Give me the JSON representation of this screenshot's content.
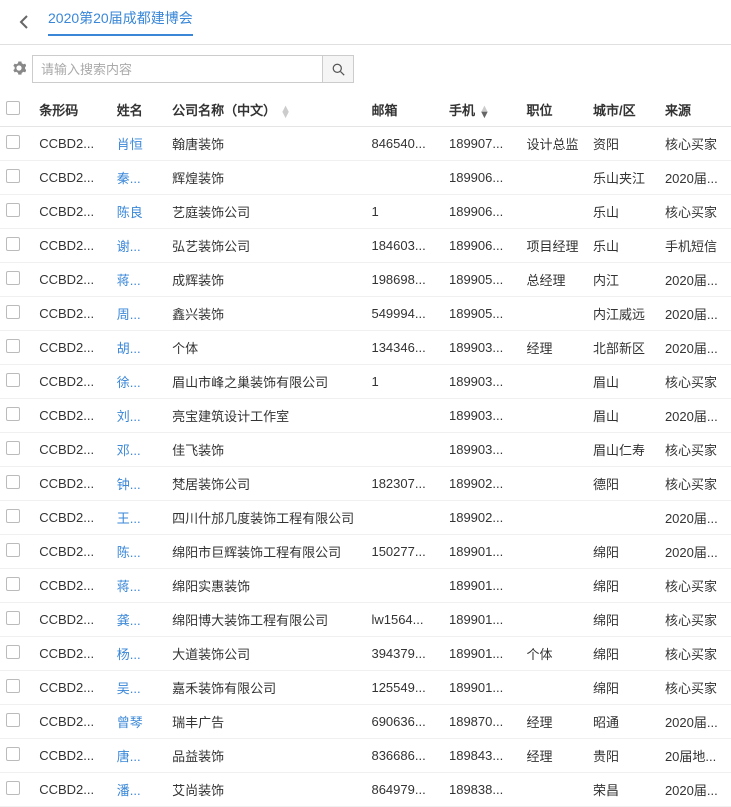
{
  "header": {
    "breadcrumb": "2020第20届成都建博会"
  },
  "search": {
    "placeholder": "请输入搜索内容"
  },
  "columns": {
    "barcode": "条形码",
    "name": "姓名",
    "company": "公司名称（中文）",
    "email": "邮箱",
    "phone": "手机",
    "position": "职位",
    "city": "城市/区",
    "source": "来源"
  },
  "rows": [
    {
      "barcode": "CCBD2...",
      "name": "肖恒",
      "company": "翰唐装饰",
      "email": "846540...",
      "phone": "189907...",
      "position": "设计总监",
      "city": "资阳",
      "source": "核心买家"
    },
    {
      "barcode": "CCBD2...",
      "name": "秦...",
      "company": "辉煌装饰",
      "email": "",
      "phone": "189906...",
      "position": "",
      "city": "乐山夹江",
      "source": "2020届..."
    },
    {
      "barcode": "CCBD2...",
      "name": "陈良",
      "company": "艺庭装饰公司",
      "email": "1",
      "phone": "189906...",
      "position": "",
      "city": "乐山",
      "source": "核心买家"
    },
    {
      "barcode": "CCBD2...",
      "name": "谢...",
      "company": "弘艺装饰公司",
      "email": "184603...",
      "phone": "189906...",
      "position": "项目经理",
      "city": "乐山",
      "source": "手机短信"
    },
    {
      "barcode": "CCBD2...",
      "name": "蒋...",
      "company": "成辉装饰",
      "email": "198698...",
      "phone": "189905...",
      "position": "总经理",
      "city": "内江",
      "source": "2020届..."
    },
    {
      "barcode": "CCBD2...",
      "name": "周...",
      "company": "鑫兴装饰",
      "email": "549994...",
      "phone": "189905...",
      "position": "",
      "city": "内江威远",
      "source": "2020届..."
    },
    {
      "barcode": "CCBD2...",
      "name": "胡...",
      "company": "个体",
      "email": "134346...",
      "phone": "189903...",
      "position": "经理",
      "city": "北部新区",
      "source": "2020届..."
    },
    {
      "barcode": "CCBD2...",
      "name": "徐...",
      "company": "眉山市峰之巢装饰有限公司",
      "email": "1",
      "phone": "189903...",
      "position": "",
      "city": "眉山",
      "source": "核心买家"
    },
    {
      "barcode": "CCBD2...",
      "name": "刘...",
      "company": "亮宝建筑设计工作室",
      "email": "",
      "phone": "189903...",
      "position": "",
      "city": "眉山",
      "source": "2020届..."
    },
    {
      "barcode": "CCBD2...",
      "name": "邓...",
      "company": "佳飞装饰",
      "email": "",
      "phone": "189903...",
      "position": "",
      "city": "眉山仁寿",
      "source": "核心买家"
    },
    {
      "barcode": "CCBD2...",
      "name": "钟...",
      "company": "梵居装饰公司",
      "email": "182307...",
      "phone": "189902...",
      "position": "",
      "city": "德阳",
      "source": "核心买家"
    },
    {
      "barcode": "CCBD2...",
      "name": "王...",
      "company": "四川什邡几度装饰工程有限公司",
      "email": "",
      "phone": "189902...",
      "position": "",
      "city": "",
      "source": "2020届..."
    },
    {
      "barcode": "CCBD2...",
      "name": "陈...",
      "company": "绵阳市巨辉装饰工程有限公司",
      "email": "150277...",
      "phone": "189901...",
      "position": "",
      "city": "绵阳",
      "source": "2020届..."
    },
    {
      "barcode": "CCBD2...",
      "name": "蒋...",
      "company": "绵阳实惠装饰",
      "email": "",
      "phone": "189901...",
      "position": "",
      "city": "绵阳",
      "source": "核心买家"
    },
    {
      "barcode": "CCBD2...",
      "name": "龚...",
      "company": "绵阳博大装饰工程有限公司",
      "email": "lw1564...",
      "phone": "189901...",
      "position": "",
      "city": "绵阳",
      "source": "核心买家"
    },
    {
      "barcode": "CCBD2...",
      "name": "杨...",
      "company": "大道装饰公司",
      "email": "394379...",
      "phone": "189901...",
      "position": "个体",
      "city": "绵阳",
      "source": "核心买家"
    },
    {
      "barcode": "CCBD2...",
      "name": "吴...",
      "company": "嘉禾装饰有限公司",
      "email": "125549...",
      "phone": "189901...",
      "position": "",
      "city": "绵阳",
      "source": "核心买家"
    },
    {
      "barcode": "CCBD2...",
      "name": "曾琴",
      "company": "瑞丰广告",
      "email": "690636...",
      "phone": "189870...",
      "position": "经理",
      "city": "昭通",
      "source": "2020届..."
    },
    {
      "barcode": "CCBD2...",
      "name": "唐...",
      "company": "品益装饰",
      "email": "836686...",
      "phone": "189843...",
      "position": "经理",
      "city": "贵阳",
      "source": "20届地..."
    },
    {
      "barcode": "CCBD2...",
      "name": "潘...",
      "company": "艾尚装饰",
      "email": "864979...",
      "phone": "189838...",
      "position": "",
      "city": "荣昌",
      "source": "2020届..."
    }
  ]
}
